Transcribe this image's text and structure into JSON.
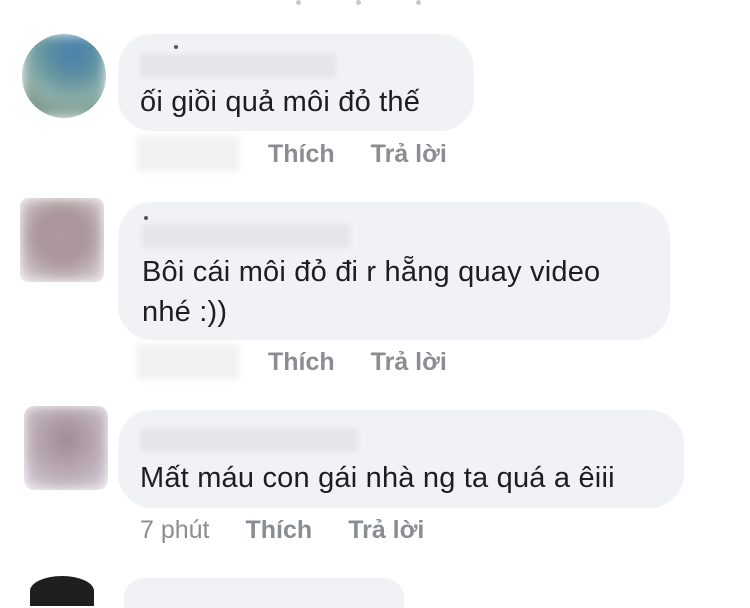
{
  "comments": [
    {
      "text": "ối giồi quả môi đỏ thế",
      "like_label": "Thích",
      "reply_label": "Trả lời",
      "time": ""
    },
    {
      "text_line1": "Bôi cái môi đỏ đi r hẵng quay video",
      "text_line2": "nhé :))",
      "like_label": "Thích",
      "reply_label": "Trả lời",
      "time": ""
    },
    {
      "text": "Mất máu con gái nhà ng ta quá a êiii",
      "like_label": "Thích",
      "reply_label": "Trả lời",
      "time": "7 phút"
    }
  ],
  "colors": {
    "bubble": "#f0f2f5",
    "action_text": "#8a8d91",
    "comment_text": "#1c1e21"
  }
}
